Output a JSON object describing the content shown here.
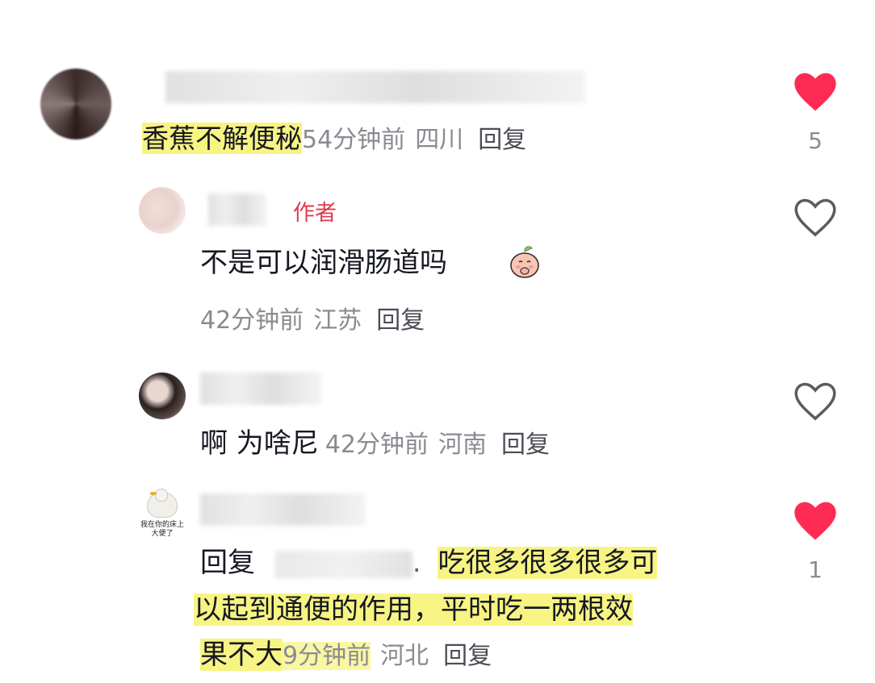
{
  "comments": [
    {
      "username": "",
      "text": "香蕉不解便秘",
      "time": "54分钟前",
      "location": "四川",
      "reply_label": "回复",
      "liked": true,
      "like_count": "5"
    },
    {
      "username": "",
      "author_tag": "作者",
      "text": "不是可以润滑肠道吗",
      "emoji": "peach-emoji",
      "time": "42分钟前",
      "location": "江苏",
      "reply_label": "回复",
      "liked": false
    },
    {
      "username": "",
      "text": "啊 为啥尼",
      "time": "42分钟前",
      "location": "河南",
      "reply_label": "回复",
      "liked": false
    },
    {
      "username": "",
      "avatar_caption": "我在你的床上大便了",
      "reply_prefix": "回复",
      "reply_target": "",
      "text_line1": "吃很多很多很多可",
      "text_line2": "以起到通便的作用，平时吃一两根效",
      "text_line3": "果不大",
      "time": "9分钟前",
      "location": "河北",
      "reply_label": "回复",
      "liked": true,
      "like_count": "1"
    }
  ],
  "colors": {
    "liked_heart": "#fe2c55",
    "outline_heart": "#5a5b63",
    "highlight": "#f4f05a",
    "author_tag": "#e13a4e"
  }
}
